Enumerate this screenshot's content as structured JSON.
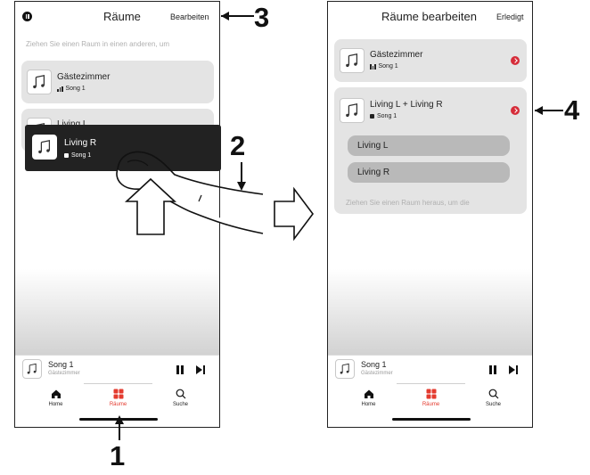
{
  "left_phone": {
    "header": {
      "pause_icon": "pause-circle-icon",
      "title": "Räume",
      "action": "Bearbeiten"
    },
    "hint": "Ziehen Sie einen Raum in einen anderen, um",
    "rooms": [
      {
        "name": "Gästezimmer",
        "song": "Song 1",
        "status_icon": "playing-bars-icon"
      },
      {
        "name": "Living L",
        "song": ""
      }
    ],
    "dragged_room": {
      "name": "Living R",
      "song": "Song 1",
      "status_icon": "stopped-square-icon"
    },
    "now_playing": {
      "song": "Song 1",
      "room": "Gästezimmer"
    },
    "tabs": [
      {
        "label": "Home",
        "icon": "home-icon"
      },
      {
        "label": "Räume",
        "icon": "rooms-icon",
        "active": true
      },
      {
        "label": "Suche",
        "icon": "search-icon"
      }
    ]
  },
  "right_phone": {
    "header": {
      "title": "Räume bearbeiten",
      "action": "Erledigt"
    },
    "rooms": [
      {
        "name": "Gästezimmer",
        "song": "Song 1",
        "status_icon": "playing-bars-icon"
      }
    ],
    "group": {
      "name": "Living L + Living R",
      "song": "Song 1",
      "status_icon": "stopped-square-icon",
      "members": [
        "Living L",
        "Living R"
      ],
      "hint": "Ziehen Sie einen Raum heraus, um die"
    },
    "now_playing": {
      "song": "Song 1",
      "room": "Gästezimmer"
    },
    "tabs": [
      {
        "label": "Home",
        "icon": "home-icon"
      },
      {
        "label": "Räume",
        "icon": "rooms-icon",
        "active": true
      },
      {
        "label": "Suche",
        "icon": "search-icon"
      }
    ]
  },
  "callouts": {
    "one": "1",
    "two": "2",
    "three": "3",
    "four": "4"
  },
  "colors": {
    "accent_red": "#d62d3a",
    "active_tab": "#e43b2f",
    "card_gray": "#e4e4e4",
    "member_gray": "#b9b9b9"
  }
}
